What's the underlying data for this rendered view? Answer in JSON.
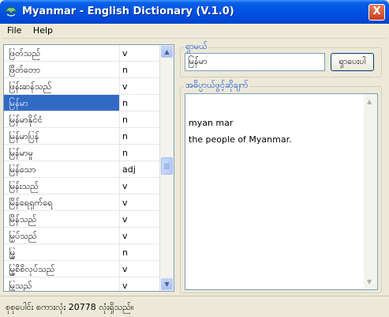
{
  "window": {
    "title": "Myanmar - English Dictionary (V.1.0)",
    "close_glyph": "X"
  },
  "menu": [
    {
      "label": "File"
    },
    {
      "label": "Help"
    }
  ],
  "word_list": [
    {
      "word": "ဖြတ်သည်",
      "pos": "v"
    },
    {
      "word": "ဖြိတ်တော",
      "pos": "n"
    },
    {
      "word": "ဖြန်းဆန်သည်",
      "pos": "v"
    },
    {
      "word": "မြန်မာ",
      "pos": "n",
      "selected": true
    },
    {
      "word": "မြန်မာနိုင်ငံ",
      "pos": "n"
    },
    {
      "word": "မြန်မာပြန်",
      "pos": "n"
    },
    {
      "word": "မြန်မာမှု",
      "pos": "n"
    },
    {
      "word": "မြန်သော",
      "pos": "adj"
    },
    {
      "word": "မြန်းသည်",
      "pos": "v"
    },
    {
      "word": "မြိန်ရေရှက်ရေ",
      "pos": "v"
    },
    {
      "word": "မြိန်သည်",
      "pos": "v"
    },
    {
      "word": "မြှပ်သည်",
      "pos": "v"
    },
    {
      "word": "မြွှ",
      "pos": "n"
    },
    {
      "word": "မြွှစိစိလုပ်သည်",
      "pos": "v"
    },
    {
      "word": "မြွှသည်",
      "pos": "v"
    }
  ],
  "search": {
    "legend": "ရှာမယ်",
    "value": "မြန်မာ",
    "button_label": "ရှာပေးပါ"
  },
  "definition": {
    "legend": "အဓိပ္ပာယ်ဖွင့်ဆိုချက်",
    "lines": [
      "myan mar",
      "the people of Myanmar."
    ]
  },
  "status": {
    "text": "စုစုပေါင်း စကားလုံး  20778 လုံးရှိသည်။"
  },
  "colors": {
    "title_bar": "#0054e3",
    "selection": "#316ac5",
    "legend_text": "#0046d5",
    "window_bg": "#ece9d8"
  },
  "icons": {
    "app": "app-logo-icon",
    "close": "close-icon",
    "scroll_up": "chevron-up-icon",
    "scroll_down": "chevron-down-icon"
  }
}
